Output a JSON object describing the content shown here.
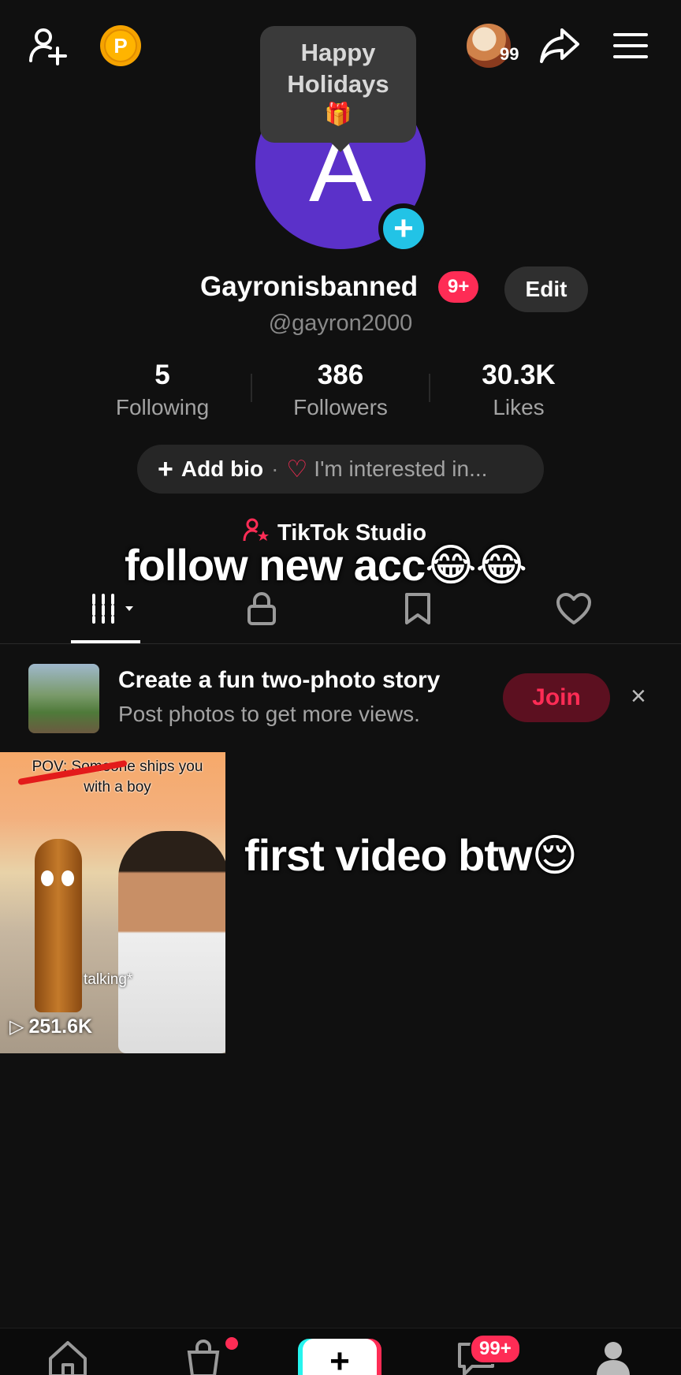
{
  "tooltip": {
    "line1": "Happy",
    "line2": "Holidays",
    "emoji": "🎁"
  },
  "header": {
    "coin_label": "P",
    "story_count": "99"
  },
  "profile": {
    "avatar_letter": "A",
    "username": "Gayronisbanned",
    "notification_badge": "9+",
    "edit_label": "Edit",
    "handle": "@gayron2000"
  },
  "stats": [
    {
      "value": "5",
      "label": "Following"
    },
    {
      "value": "386",
      "label": "Followers"
    },
    {
      "value": "30.3K",
      "label": "Likes"
    }
  ],
  "bio": {
    "add_label": "Add bio",
    "separator": "·",
    "interest_label": "I'm interested in..."
  },
  "studio": {
    "label": "TikTok Studio"
  },
  "captions": {
    "first": "follow new acc😂😂",
    "second": "first video btw😌"
  },
  "promo": {
    "title": "Create a fun two-photo story",
    "subtitle": "Post photos to get more views.",
    "join_label": "Join",
    "close_label": "×"
  },
  "video": {
    "top_text": "POV: Someone ships you with a boy",
    "overlay_text": "talking*",
    "views": "251.6K"
  },
  "bottom_nav": {
    "inbox_badge": "99+"
  },
  "colors": {
    "accent": "#fe2c55",
    "avatar_bg": "#5b31c9",
    "add_blue": "#22c3e6",
    "background": "#101010"
  }
}
